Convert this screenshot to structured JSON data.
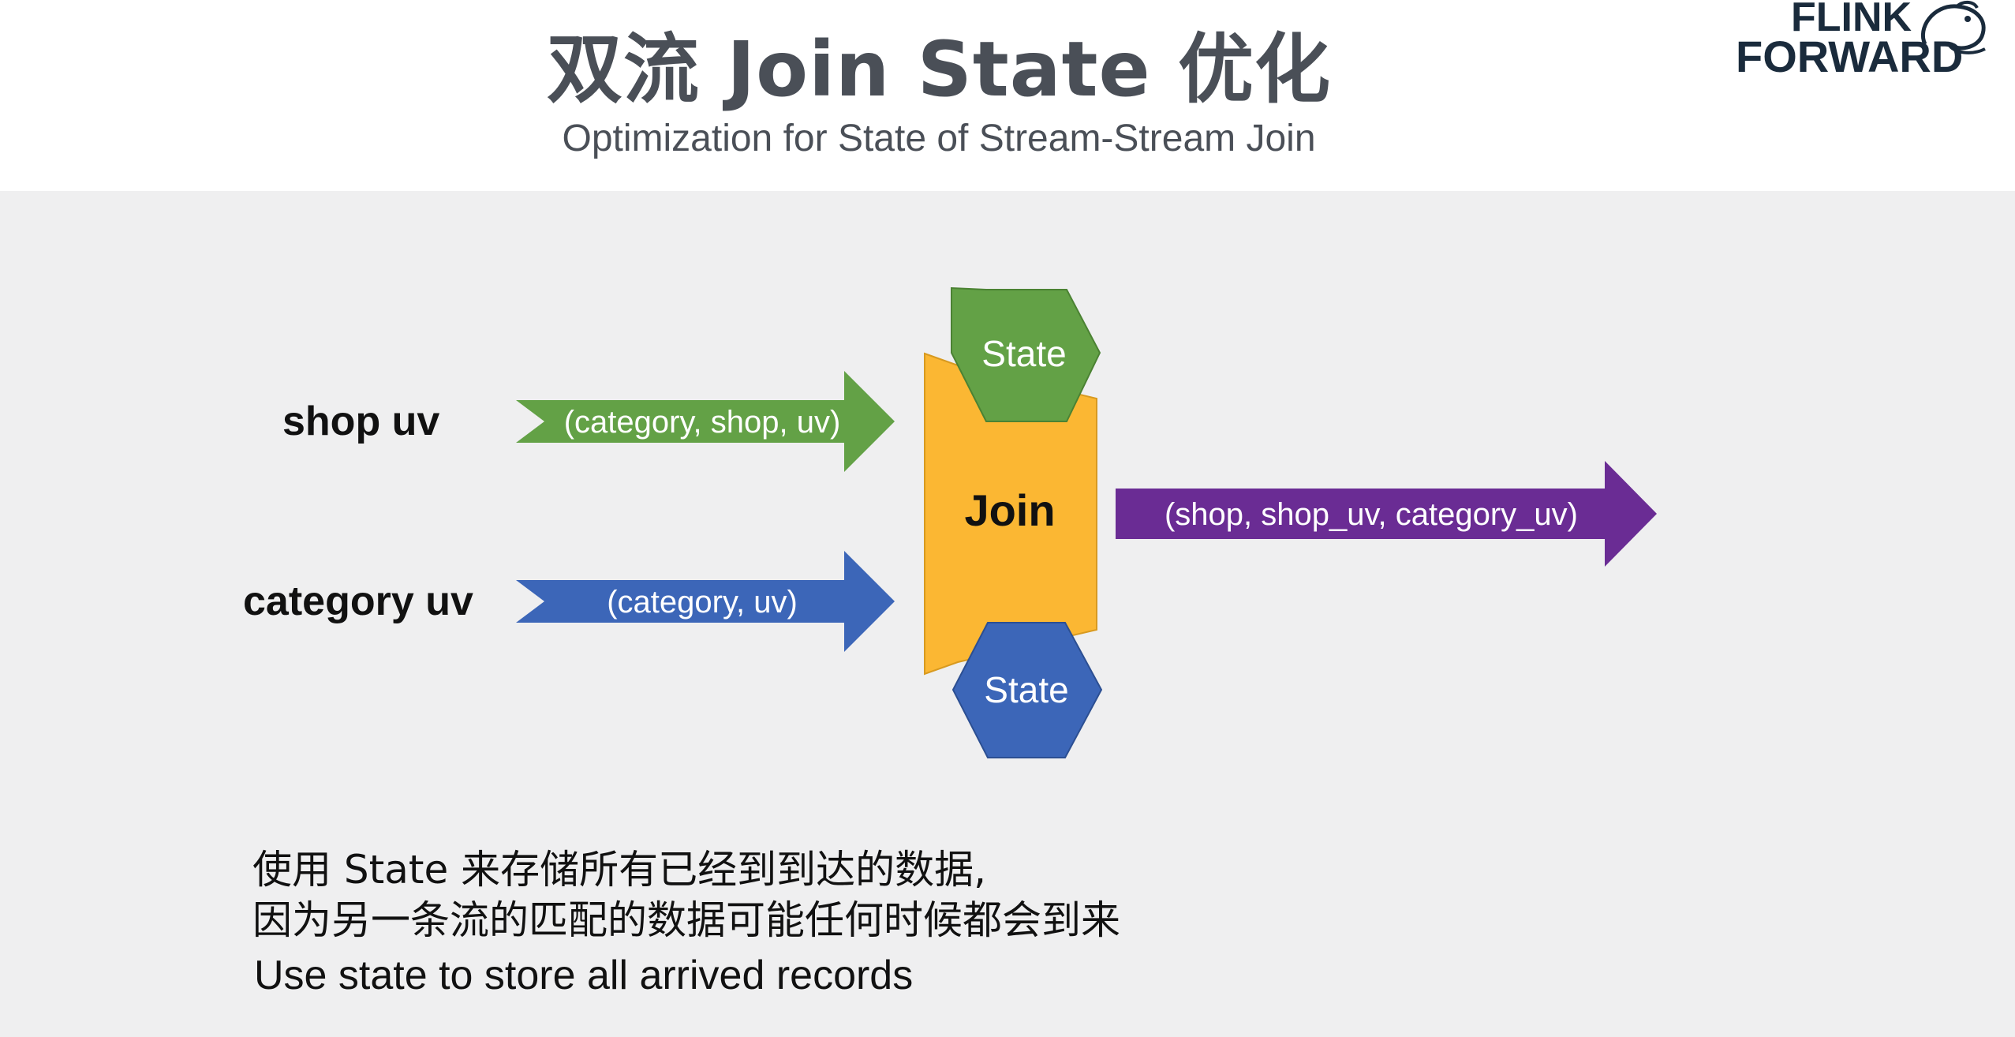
{
  "header": {
    "title": "双流 Join State 优化",
    "subtitle": "Optimization for State of Stream-Stream Join",
    "logo": {
      "line1": "FLINK",
      "line2": "FORWARD"
    }
  },
  "diagram": {
    "inputs": [
      {
        "label": "shop uv",
        "arrow_text": "(category, shop, uv)",
        "color": "#63a146"
      },
      {
        "label": "category uv",
        "arrow_text": "(category, uv)",
        "color": "#3c66b8"
      }
    ],
    "join": {
      "label": "Join",
      "color": "#fbb733"
    },
    "states": [
      {
        "label": "State",
        "color": "#63a146"
      },
      {
        "label": "State",
        "color": "#3c66b8"
      }
    ],
    "output": {
      "arrow_text": "(shop, shop_uv, category_uv)",
      "color": "#6a2c94"
    }
  },
  "notes": {
    "zh_line1": "使用 State 来存储所有已经到到达的数据,",
    "zh_line2": "因为另一条流的匹配的数据可能任何时候都会到来",
    "en": "Use state to store all arrived records"
  },
  "colors": {
    "background": "#efeff0",
    "heading": "#4a4f57"
  }
}
